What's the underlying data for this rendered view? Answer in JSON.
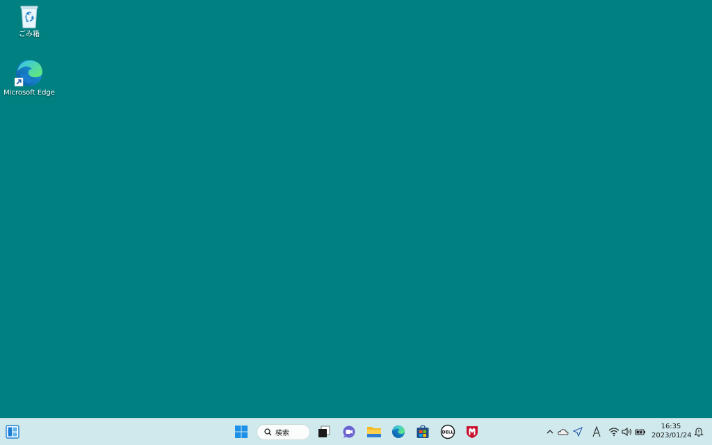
{
  "desktop": {
    "background_color": "#008080",
    "icons": [
      {
        "name": "recycle-bin",
        "label": "ごみ箱"
      },
      {
        "name": "microsoft-edge",
        "label": "Microsoft Edge"
      }
    ]
  },
  "taskbar": {
    "search_label": "検索",
    "pinned_apps": [
      "widgets",
      "start",
      "search",
      "task-view",
      "teams-chat",
      "file-explorer",
      "edge",
      "microsoft-store",
      "dell",
      "mcafee"
    ],
    "tray_icons": [
      "chevron-up",
      "onedrive",
      "location",
      "ime-a",
      "wifi",
      "volume",
      "battery"
    ],
    "clock": {
      "time": "16:35",
      "date": "2023/01/24"
    }
  }
}
